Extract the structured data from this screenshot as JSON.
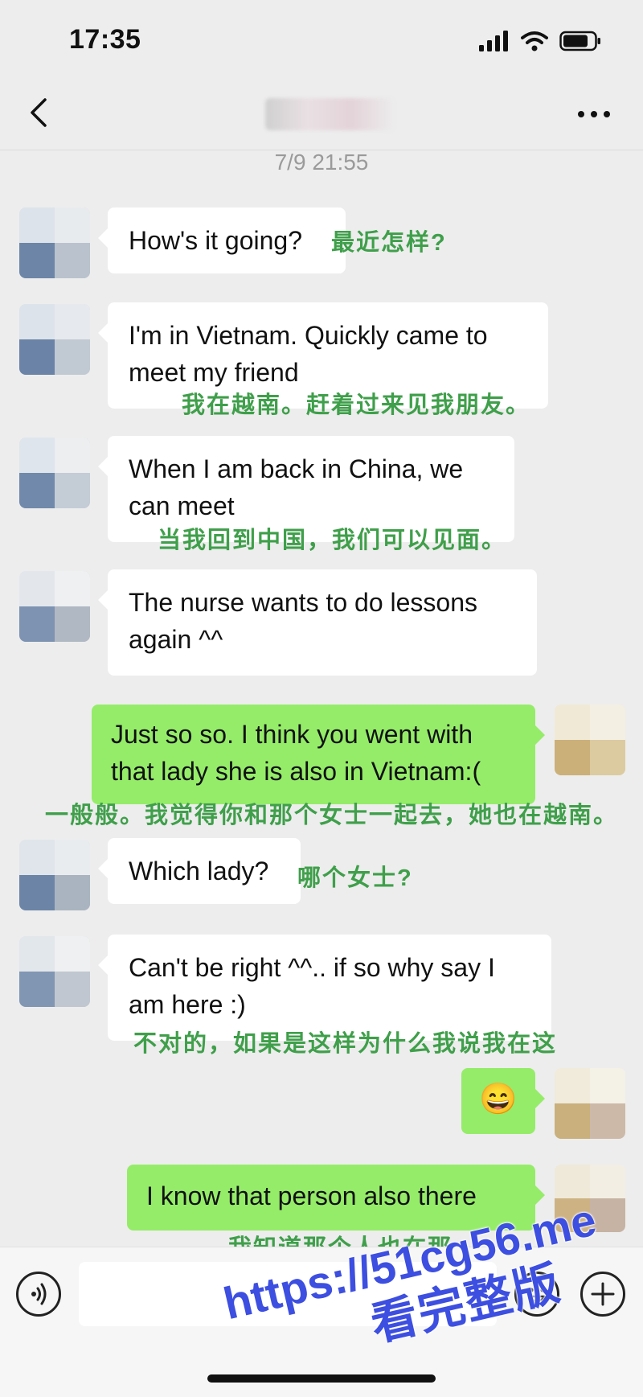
{
  "status_bar": {
    "time": "17:35"
  },
  "chat": {
    "date_separator": "7/9 21:55"
  },
  "messages": [
    {
      "side": "in",
      "text": "How's it going?",
      "zh": "最近怎样?"
    },
    {
      "side": "in",
      "text": "I'm in Vietnam. Quickly came to meet my friend",
      "zh": "我在越南。赶着过来见我朋友。"
    },
    {
      "side": "in",
      "text": "When I am back in China, we can meet",
      "zh": "当我回到中国，我们可以见面。"
    },
    {
      "side": "in",
      "text": "The nurse wants to do lessons again ^^",
      "zh": ""
    },
    {
      "side": "out",
      "text": "Just so so. I think you went with that lady she is also in Vietnam:(",
      "zh": "一般般。我觉得你和那个女士一起去，她也在越南。"
    },
    {
      "side": "in",
      "text": "Which lady?",
      "zh": "哪个女士?"
    },
    {
      "side": "in",
      "text": "Can't be right ^^.. if so why say I am here :)",
      "zh": "不对的，如果是这样为什么我说我在这"
    },
    {
      "side": "out",
      "text": "😄",
      "zh": ""
    },
    {
      "side": "out",
      "text": "I know that person also there",
      "zh": "我知道那个人也在那"
    }
  ],
  "watermark": {
    "url": "https://51cg56.me",
    "label": "看完整版"
  },
  "icons": [
    "back-icon",
    "more-icon",
    "signal-icon",
    "wifi-icon",
    "battery-icon",
    "voice-icon",
    "emoji-icon",
    "plus-icon"
  ]
}
